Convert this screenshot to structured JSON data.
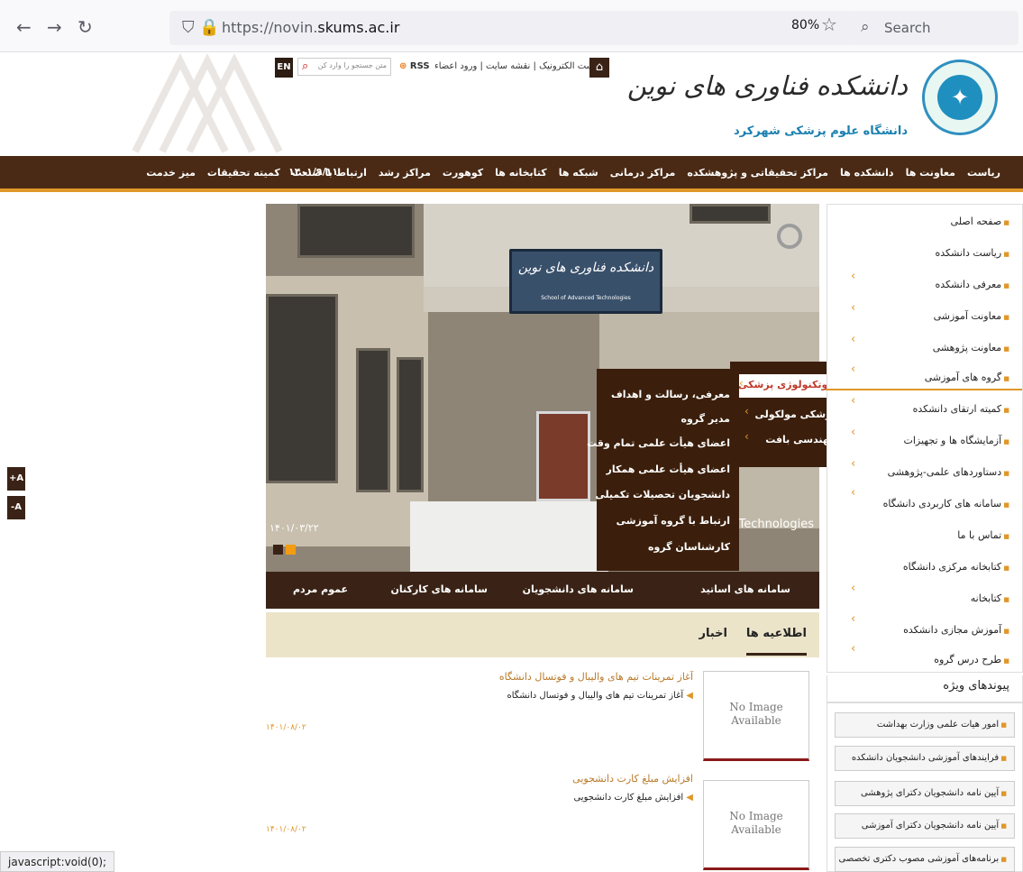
{
  "browser": {
    "url_prefix": "https://novin.",
    "url_domain": "skums.ac.ir",
    "zoom": "80%",
    "search_placeholder": "Search",
    "status_text": "javascript:void(0);"
  },
  "header": {
    "en_label": "EN",
    "search_placeholder": "متن جستجو را وارد کن",
    "rss_label": "RSS",
    "links": "پست الکترونیک | نقشه سایت | ورود اعضاء |",
    "site_name": "دانشکده فناوری های نوین",
    "site_subtitle": "دانشگاه علوم پزشکی شهرکرد"
  },
  "mainnav": {
    "items": [
      "ریاست",
      "معاونت ها",
      "دانشکده ها",
      "مراکز تحقیقاتی و پژوهشکده",
      "مراکز درمانی",
      "شبکه ها",
      "کتابخانه ها",
      "کوهورت",
      "مراکز رشد",
      "ارتباط با صنعت",
      "کمیته تحقیقات",
      "میز خدمت"
    ],
    "date": "۱۴۰۱/۹/۱۱"
  },
  "font_buttons": [
    "+A",
    "-A"
  ],
  "sidebar": {
    "items": [
      "صفحه اصلی",
      "ریاست دانشکده",
      "معرفی دانشکده",
      "معاونت آموزشی",
      "معاونت پژوهشی",
      "گروه های آموزشی",
      "کمیته ارتقای دانشکده",
      "آزمایشگاه ها و تجهیزات",
      "دستاوردهای علمی-پژوهشی",
      "سامانه های کاربردی دانشگاه",
      "تماس با ما",
      "کتابخانه مرکزی دانشگاه",
      "کتابخانه",
      "آموزش مجازی دانشکده",
      "طرح درس گروه"
    ],
    "special_title": "پیوندهای ویژه",
    "special_links": [
      "امور هیات علمی وزارت بهداشت",
      "فرایندهای آموزشی دانشجویان دانشکده",
      "آیین نامه دانشجویان دکترای پژوهشی",
      "آیین نامه دانشجویان دکترای آموزشی",
      "برنامه‌های آموزشی مصوب دکتری تخصصی"
    ]
  },
  "slider": {
    "sign_text": "دانشکده فناوری های نوین",
    "sign_small": "School of Advanced Technologies",
    "date": "۱۴۰۱/۰۳/۲۲",
    "caption": "ed Technologies"
  },
  "dropdown": {
    "groups": [
      "بیوتکنولوژی پزشکی",
      "پزشکی مولکولی",
      "مهندسی بافت"
    ],
    "panel": [
      "معرفی، رسالت و اهداف",
      "مدیر گروه",
      "اعضای هیأت علمی تمام وقت",
      "اعضای هیأت علمی همکار",
      "دانشجویان تحصیلات تکمیلی",
      "ارتباط با گروه آموزشی",
      "کارشناسان گروه"
    ]
  },
  "services": [
    "سامانه های اساتید",
    "سامانه های دانشجویان",
    "سامانه های کارکنان",
    "عموم مردم"
  ],
  "news_tabs": [
    "اطلاعیه ها",
    "اخبار"
  ],
  "news": [
    {
      "title": "آغاز تمرینات تیم های والیبال و فوتسال دانشگاه",
      "summary": "آغاز تمرینات تیم های والیبال و فوتسال دانشگاه",
      "date": "۱۴۰۱/۰۸/۰۲",
      "img": "No Image Available"
    },
    {
      "title": "افزایش مبلغ کارت دانشجویی",
      "summary": "افزایش مبلغ کارت دانشجویی",
      "date": "۱۴۰۱/۰۸/۰۲",
      "img": "No Image Available"
    }
  ],
  "colors": {
    "brown": "#4a2a14",
    "accent": "#e0972a",
    "dark": "#3b1f0c"
  }
}
